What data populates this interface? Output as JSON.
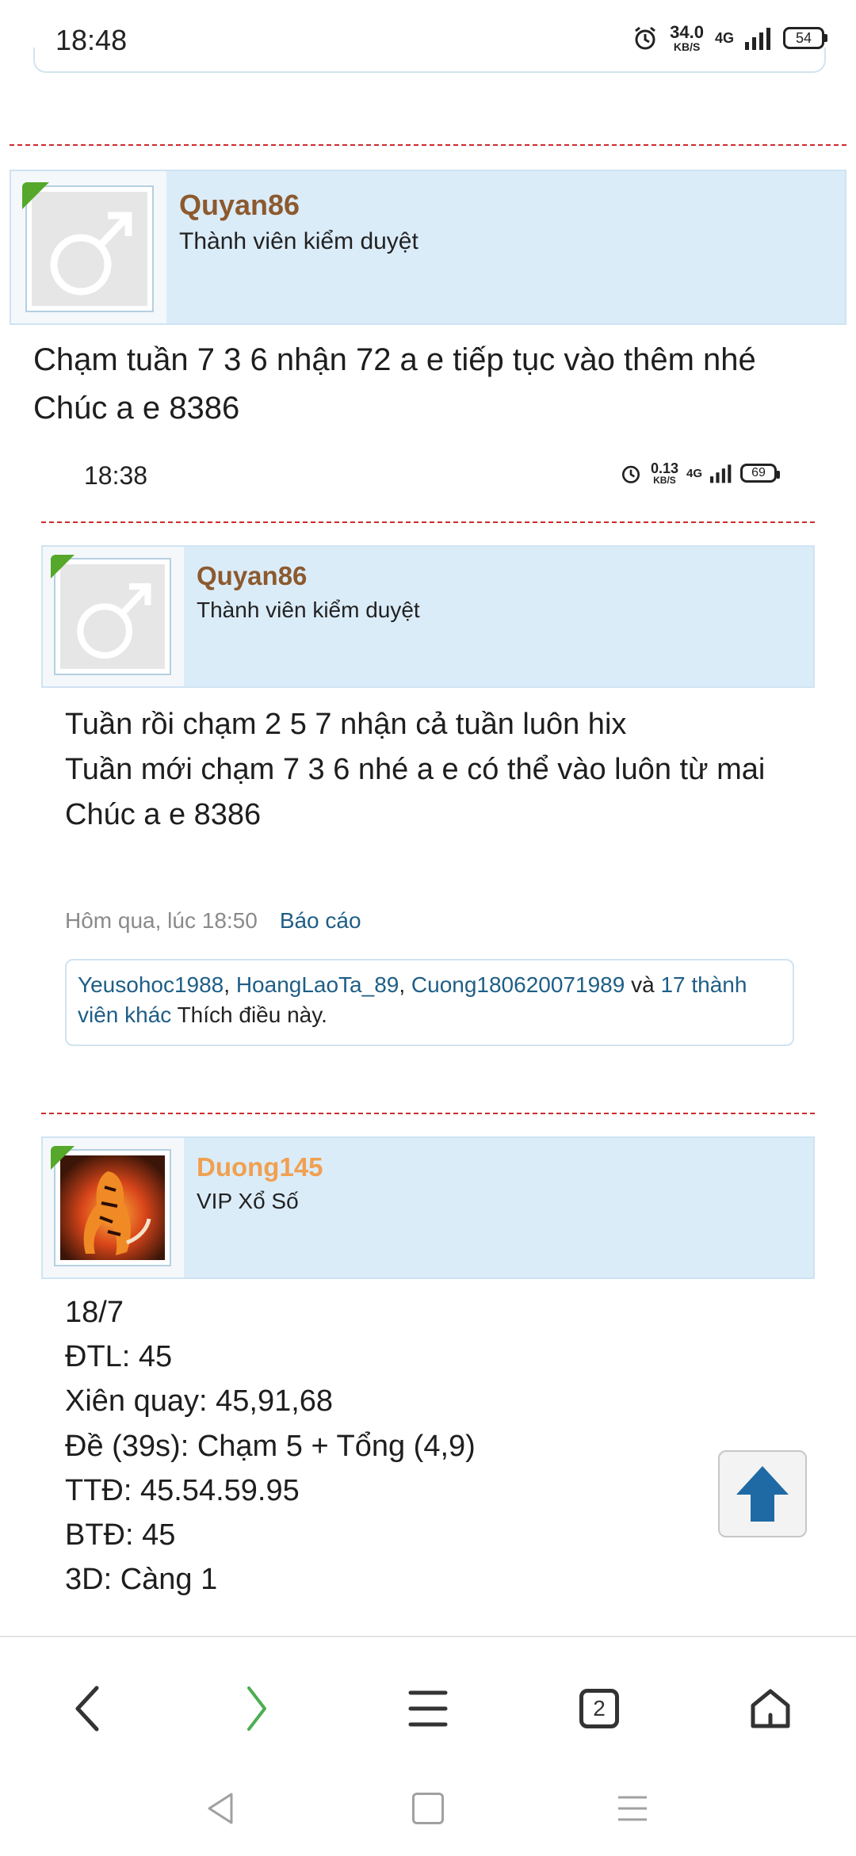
{
  "status_bar": {
    "time": "18:48",
    "net_speed_value": "34.0",
    "net_speed_unit": "KB/S",
    "network": "4G",
    "battery": "54"
  },
  "post1": {
    "author": "Quyan86",
    "role": "Thành viên kiểm duyệt",
    "text": "Chạm tuần 7 3 6 nhận 72 a e tiếp tục vào thêm nhé\nChúc a e 8386",
    "avatar_icon": "male-symbol-icon"
  },
  "embedded_screenshot": {
    "status_time": "18:38",
    "net_speed_value": "0.13",
    "net_speed_unit": "KB/S",
    "network": "4G",
    "battery": "69",
    "quoted_post": {
      "author": "Quyan86",
      "role": "Thành viên kiểm duyệt",
      "text": "Tuần rồi chạm 2 5 7 nhận cả tuần luôn hix\nTuần mới chạm 7 3 6 nhé a e có thể vào luôn từ mai\nChúc a e 8386",
      "timestamp": "Hôm qua, lúc 18:50",
      "report_label": "Báo cáo",
      "likes": {
        "user1": "Yeusohoc1988",
        "sep1": ", ",
        "user2": "HoangLaoTa_89",
        "sep2": ", ",
        "user3": "Cuong180620071989",
        "and": " và ",
        "others": "17 thành viên khác",
        "suffix": " Thích điều này."
      }
    },
    "next_post": {
      "author": "Duong145",
      "role": "VIP Xổ Số",
      "text": "18/7\nĐTL: 45\nXiên quay: 45,91,68\nĐề (39s): Chạm 5 + Tổng (4,9)\nTTĐ: 45.54.59.95\nBTĐ: 45\n3D: Càng 1"
    }
  },
  "browser_nav": {
    "tab_count": "2",
    "items": [
      "back-icon",
      "forward-icon",
      "menu-icon",
      "tabs-icon",
      "home-icon"
    ]
  },
  "colors": {
    "username_brown": "#8c5a2e",
    "username_orange": "#f0a050",
    "header_bg": "#dbecf9",
    "link": "#1e5e86",
    "divider_red": "#cc2b2b",
    "scroll_arrow": "#1f6aa5",
    "forward_green": "#4caf50"
  }
}
